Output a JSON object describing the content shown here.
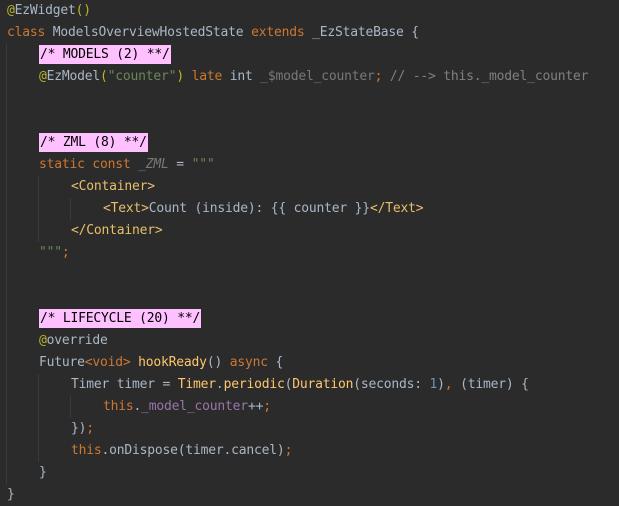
{
  "editor": {
    "theme": {
      "background": "#2b2b2b",
      "keyword": "#cc7832",
      "annotation": "#bbb529",
      "string": "#6a8759",
      "number": "#6897bb",
      "function": "#ffc66d",
      "field": "#9876aa",
      "region_highlight": "#ffc0ff"
    },
    "lines": [
      {
        "tokens": [
          {
            "t": "@",
            "c": "ann"
          },
          {
            "t": "EzWidget",
            "c": "plain"
          },
          {
            "t": "()",
            "c": "ann"
          }
        ]
      },
      {
        "tokens": [
          {
            "t": "class ",
            "c": "kw"
          },
          {
            "t": "ModelsOverviewHostedState ",
            "c": "plain"
          },
          {
            "t": "extends ",
            "c": "kw"
          },
          {
            "t": "_EzStateBase {",
            "c": "plain"
          }
        ]
      },
      {
        "tokens": [
          {
            "t": "/* MODELS (2) **/",
            "c": "region"
          }
        ]
      },
      {
        "tokens": [
          {
            "t": "@",
            "c": "ann"
          },
          {
            "t": "EzModel",
            "c": "plain"
          },
          {
            "t": "(",
            "c": "ann"
          },
          {
            "t": "\"counter\"",
            "c": "str"
          },
          {
            "t": ") ",
            "c": "ann"
          },
          {
            "t": "late ",
            "c": "kw"
          },
          {
            "t": "int ",
            "c": "int"
          },
          {
            "t": "_$model_counter",
            "c": "dim"
          },
          {
            "t": "; ",
            "c": "kw"
          },
          {
            "t": "// --> this._model_counter",
            "c": "comment"
          }
        ]
      },
      {
        "tokens": []
      },
      {
        "tokens": []
      },
      {
        "tokens": [
          {
            "t": "/* ZML (8) **/",
            "c": "region"
          }
        ]
      },
      {
        "tokens": [
          {
            "t": "static const ",
            "c": "kw"
          },
          {
            "t": "_ZML",
            "c": "italic"
          },
          {
            "t": " = ",
            "c": "plain"
          },
          {
            "t": "\"\"\"",
            "c": "str"
          }
        ]
      },
      {
        "tokens": [
          {
            "t": "<Container>",
            "c": "tag"
          }
        ]
      },
      {
        "tokens": [
          {
            "t": "<Text>",
            "c": "tag"
          },
          {
            "t": "Count (inside): {{ counter }}",
            "c": "plain"
          },
          {
            "t": "</Text>",
            "c": "tag"
          }
        ]
      },
      {
        "tokens": [
          {
            "t": "</Container>",
            "c": "tag"
          }
        ]
      },
      {
        "tokens": [
          {
            "t": "\"\"\"",
            "c": "str"
          },
          {
            "t": ";",
            "c": "kw"
          }
        ]
      },
      {
        "tokens": []
      },
      {
        "tokens": []
      },
      {
        "tokens": [
          {
            "t": "/* LIFECYCLE (20) **/",
            "c": "region"
          }
        ]
      },
      {
        "tokens": [
          {
            "t": "@",
            "c": "ann"
          },
          {
            "t": "override",
            "c": "plain"
          }
        ]
      },
      {
        "tokens": [
          {
            "t": "Future",
            "c": "plain"
          },
          {
            "t": "<void>",
            "c": "kw"
          },
          {
            "t": " ",
            "c": "plain"
          },
          {
            "t": "hookReady",
            "c": "fn"
          },
          {
            "t": "() ",
            "c": "plain"
          },
          {
            "t": "async ",
            "c": "kw"
          },
          {
            "t": "{",
            "c": "plain"
          }
        ]
      },
      {
        "tokens": [
          {
            "t": "Timer timer = ",
            "c": "plain"
          },
          {
            "t": "Timer",
            "c": "fn"
          },
          {
            "t": ".",
            "c": "plain"
          },
          {
            "t": "periodic",
            "c": "fn"
          },
          {
            "t": "(",
            "c": "plain"
          },
          {
            "t": "Duration",
            "c": "fn"
          },
          {
            "t": "(seconds: ",
            "c": "plain"
          },
          {
            "t": "1",
            "c": "num"
          },
          {
            "t": ")",
            "c": "plain"
          },
          {
            "t": ", ",
            "c": "kw"
          },
          {
            "t": "(timer) {",
            "c": "plain"
          }
        ]
      },
      {
        "tokens": [
          {
            "t": "this",
            "c": "kw"
          },
          {
            "t": ".",
            "c": "plain"
          },
          {
            "t": "_model_counter",
            "c": "field"
          },
          {
            "t": "++",
            "c": "plain"
          },
          {
            "t": ";",
            "c": "kw"
          }
        ]
      },
      {
        "tokens": [
          {
            "t": "})",
            "c": "plain"
          },
          {
            "t": ";",
            "c": "kw"
          }
        ]
      },
      {
        "tokens": [
          {
            "t": "this",
            "c": "kw"
          },
          {
            "t": ".onDispose(timer.cancel)",
            "c": "plain"
          },
          {
            "t": ";",
            "c": "kw"
          }
        ]
      },
      {
        "tokens": [
          {
            "t": "}",
            "c": "plain"
          }
        ]
      },
      {
        "tokens": [
          {
            "t": "}",
            "c": "plain"
          }
        ]
      }
    ]
  }
}
